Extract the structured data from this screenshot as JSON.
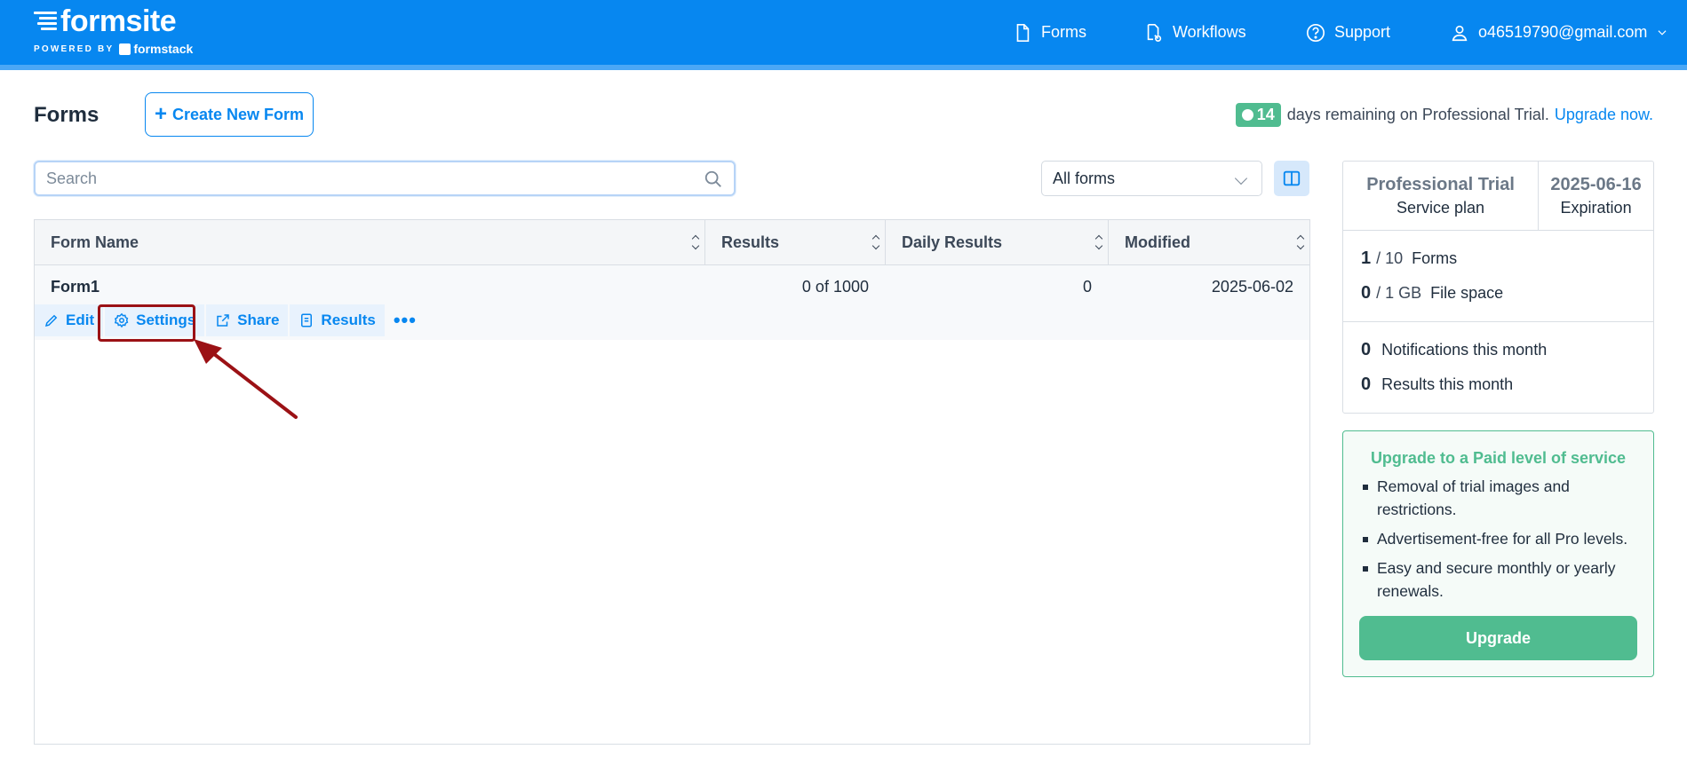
{
  "brand": {
    "name": "formsite",
    "powered_by": "POWERED BY",
    "partner": "formstack"
  },
  "nav": {
    "forms": "Forms",
    "workflows": "Workflows",
    "support": "Support",
    "account": "o46519790@gmail.com"
  },
  "page": {
    "title": "Forms",
    "create_button": "Create New Form"
  },
  "trial": {
    "days": "14",
    "text": "days remaining on Professional Trial.",
    "upgrade_link": "Upgrade now."
  },
  "search": {
    "placeholder": "Search",
    "value": ""
  },
  "filter": {
    "selected": "All forms"
  },
  "table": {
    "columns": [
      "Form Name",
      "Results",
      "Daily Results",
      "Modified"
    ],
    "rows": [
      {
        "name": "Form1",
        "results": "0 of 1000",
        "daily": "0",
        "modified": "2025-06-02"
      }
    ],
    "actions": [
      "Edit",
      "Settings",
      "Share",
      "Results",
      "•••"
    ]
  },
  "plan": {
    "name": "Professional Trial",
    "name_label": "Service plan",
    "expiration": "2025-06-16",
    "expiration_label": "Expiration",
    "forms_used": "1",
    "forms_total": "/ 10",
    "forms_label": "Forms",
    "space_used": "0",
    "space_total": "/ 1 GB",
    "space_label": "File space",
    "notifications": "0",
    "notifications_label": "Notifications this month",
    "results": "0",
    "results_label": "Results this month"
  },
  "upgrade": {
    "title": "Upgrade to a Paid level of service",
    "items": [
      "Removal of trial images and restrictions.",
      "Advertisement-free for all Pro levels.",
      "Easy and secure monthly or yearly renewals."
    ],
    "button": "Upgrade"
  },
  "colors": {
    "primary": "#0787f0",
    "accent": "#50bc90",
    "highlight": "#9b1115"
  }
}
